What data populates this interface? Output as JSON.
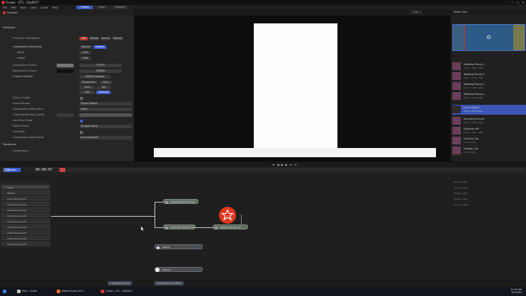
{
  "window": {
    "title": "Fusion - ST1 - Clip0017",
    "controls": [
      "—",
      "▢",
      "✕"
    ]
  },
  "menu": {
    "items": [
      "File",
      "Edit",
      "Tools",
      "View",
      "Script",
      "Help",
      "Playback",
      "Fusion",
      "Workspace"
    ],
    "tabs": [
      {
        "label": "Fusion",
        "active": true
      },
      {
        "label": "Color",
        "active": false
      },
      {
        "label": "Fairlight",
        "active": false
      }
    ]
  },
  "inspector": {
    "tool_name": "Canvas1",
    "section_header": "Attributes",
    "rows": {
      "process_mode": "Process in Interpolate",
      "comp_resolution": "Composition Resolution",
      "width": "Width",
      "height": "Height",
      "comp_color": "Composition Colour",
      "bg_colour": "Background Colour",
      "comp_camera": "Current Camera",
      "default_settings": "Default Settings",
      "color_output": "Colour Output",
      "frame_render": "Frame Render",
      "comp_motion_blur": "Composition Motion Blur",
      "comp_moblur_quality": "Comp Motion Blur Quality",
      "lock_pivot": "Lock Pivot Mode",
      "pointer_mode": "Pointer Mode",
      "film_anim": "Film Anim",
      "comp_alpha_mode": "Composition Alpha Mode",
      "compression": "Compression",
      "footer": "Transforms"
    },
    "buttons": {
      "b1": "Off",
      "b2": "Render",
      "b3": "Normal",
      "b4": "Manual",
      "b5": "Normal",
      "b6": "Custom",
      "width_val": "1920",
      "height_val": "1080",
      "color_val": "FFFFFF",
      "bg_val": "000000",
      "res1": "Hi Res",
      "res2": "Full",
      "cam1": "Perspective",
      "cam2": "Ortho",
      "cam3": "Front",
      "cam4": "Top",
      "cam5": "Side",
      "cam6": "Camera1",
      "frame_val": "Frame Default",
      "blur_val": "Static",
      "moblur_val": "1",
      "alpha_val": "Straight Alpha",
      "compress_val": "Uncompressed"
    }
  },
  "viewer": {
    "fit_label": "Fit"
  },
  "media": {
    "header": "Media Pool",
    "preview_label": "",
    "items": [
      {
        "name": "Wedding Picture_1",
        "meta": "1920 × 1080 · PNG",
        "selected": false
      },
      {
        "name": "Wedding Picture_2",
        "meta": "1920 × 1080 · PNG",
        "selected": false
      },
      {
        "name": "Wedding Picture_3",
        "meta": "1920 × 1080 · PNG",
        "selected": false
      },
      {
        "name": "Wedding Picture_4",
        "meta": "1920 × 1080 · PNG",
        "selected": false
      },
      {
        "name": "Layer Position",
        "meta": "Fusion Composition",
        "selected": true
      },
      {
        "name": "Animated Element",
        "meta": "1920 × 1080 · PNG",
        "selected": false
      },
      {
        "name": "Collection Blk",
        "meta": "1920 × 1080 · PNG",
        "selected": false
      },
      {
        "name": "Timeline_Clip",
        "meta": "00:00:05:00",
        "selected": false
      },
      {
        "name": "Footage_Clip",
        "meta": "00:00:10:00",
        "selected": false
      }
    ]
  },
  "timecode": {
    "frame": "276",
    "tc": "00:00:07"
  },
  "nodes_tab": "Nodes",
  "layers": [
    "Stage",
    "PEOPLE",
    "Video Element_01",
    "Video Element_02",
    "Video Element_03",
    "Video Element_04",
    "Video Element_05",
    "Video Element_06",
    "Video Element_07",
    "Video Element_08",
    "Video Element_09",
    "Video Element_10"
  ],
  "nodes": {
    "n1": "Element01 01010.mp4",
    "n2": "Animation Text02.mp4",
    "n3": "Merger_Merge1_01",
    "n4": "Media1",
    "n5": "Media2"
  },
  "right_notes": [
    "Anchor_List1",
    "Anchor_List2",
    "Anchor_List3",
    "Anchor_List4",
    "Anchor_List5"
  ],
  "bottom_tabs": [
    "1 Rendered_Scene",
    "Composition Animation"
  ],
  "taskbar": {
    "items": [
      "Main - Inside",
      "Adobe Fusion 2017",
      "Fusion 2024 Animation",
      "Fusion - ST1 - Clip0017"
    ],
    "time": "12:55 AM",
    "date": "9/5/2024"
  }
}
